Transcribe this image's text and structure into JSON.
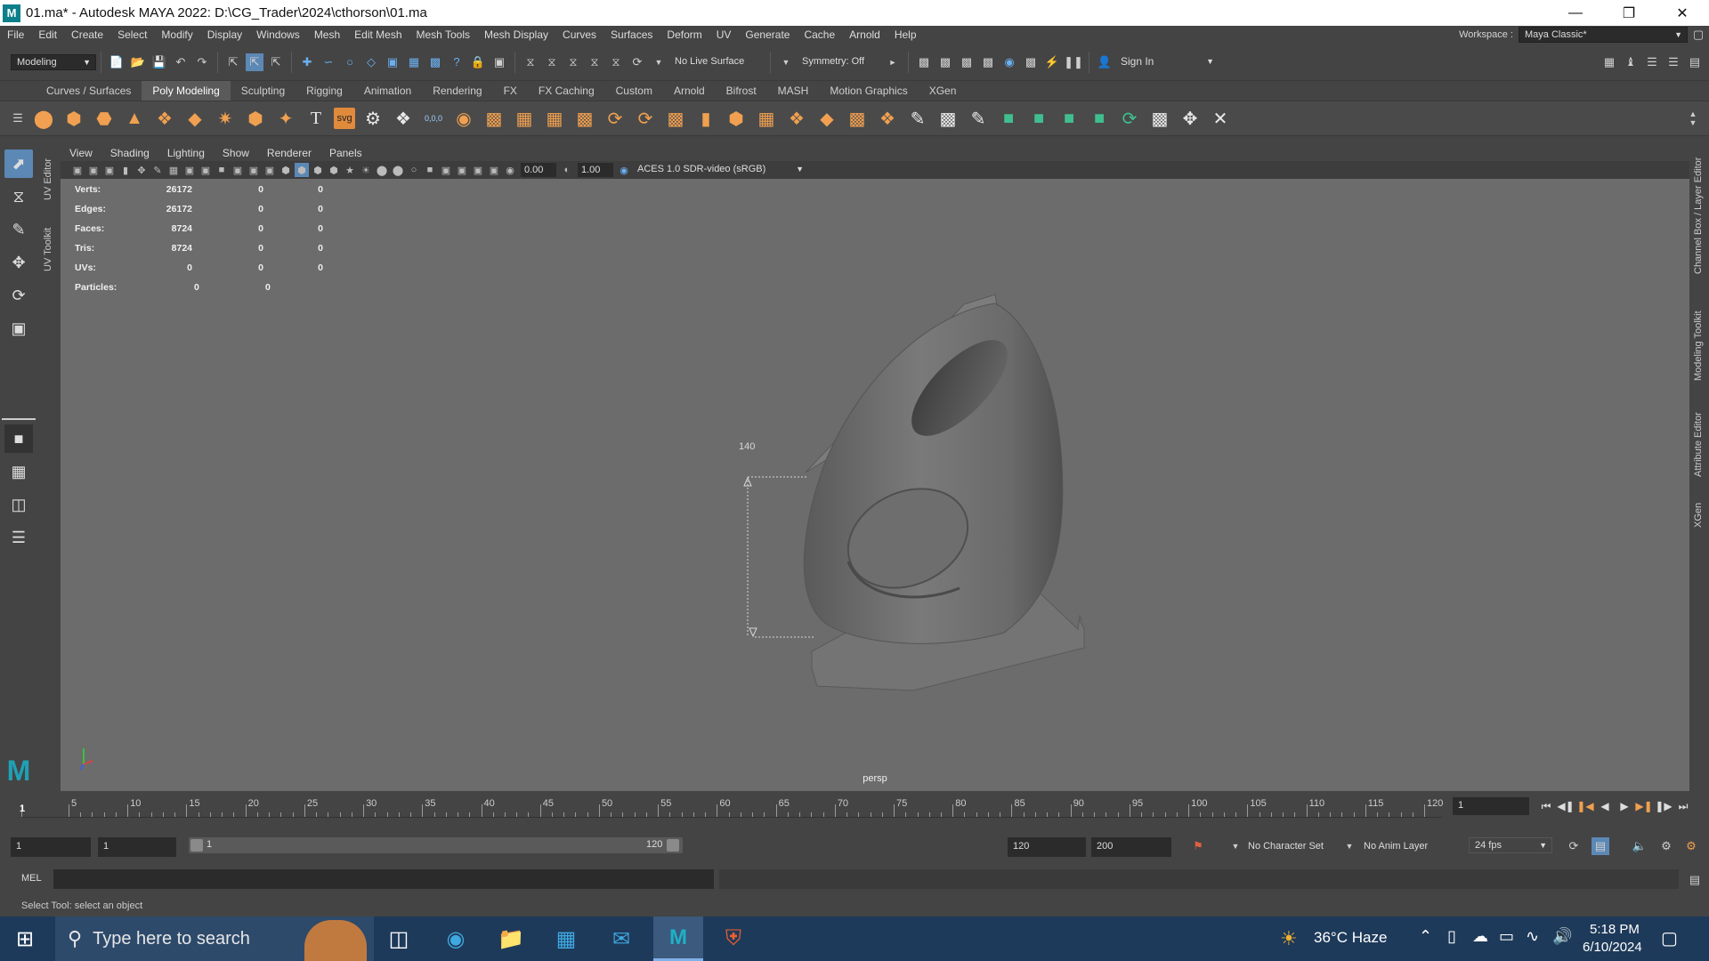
{
  "window": {
    "title": "01.ma* - Autodesk MAYA 2022: D:\\CG_Trader\\2024\\cthorson\\01.ma",
    "logo_letter": "M"
  },
  "menubar": {
    "items": [
      "File",
      "Edit",
      "Create",
      "Select",
      "Modify",
      "Display",
      "Windows",
      "Mesh",
      "Edit Mesh",
      "Mesh Tools",
      "Mesh Display",
      "Curves",
      "Surfaces",
      "Deform",
      "UV",
      "Generate",
      "Cache",
      "Arnold",
      "Help"
    ],
    "workspace_label": "Workspace :",
    "workspace_value": "Maya Classic*"
  },
  "statusline": {
    "mode": "Modeling",
    "live_surface": "No Live Surface",
    "symmetry": "Symmetry: Off",
    "sign_in": "Sign In"
  },
  "shelf": {
    "tabs": [
      "Curves / Surfaces",
      "Poly Modeling",
      "Sculpting",
      "Rigging",
      "Animation",
      "Rendering",
      "FX",
      "FX Caching",
      "Custom",
      "Arnold",
      "Bifrost",
      "MASH",
      "Motion Graphics",
      "XGen"
    ],
    "active_tab": "Poly Modeling",
    "svg_label": "svg",
    "text_label": "T",
    "num_label": "0,0,0"
  },
  "left_vertical_tabs": [
    "UV Editor",
    "UV Toolkit"
  ],
  "right_vertical_tabs": [
    "Channel Box / Layer Editor",
    "Modeling Toolkit",
    "Attribute Editor",
    "XGen"
  ],
  "panel": {
    "menus": [
      "View",
      "Shading",
      "Lighting",
      "Show",
      "Renderer",
      "Panels"
    ],
    "exposure": "0.00",
    "gamma": "1.00",
    "color_space": "ACES 1.0 SDR-video (sRGB)",
    "camera": "persp"
  },
  "hud": {
    "rows": [
      {
        "label": "Verts:",
        "v1": "26172",
        "v2": "0",
        "v3": "0"
      },
      {
        "label": "Edges:",
        "v1": "26172",
        "v2": "0",
        "v3": "0"
      },
      {
        "label": "Faces:",
        "v1": "8724",
        "v2": "0",
        "v3": "0"
      },
      {
        "label": "Tris:",
        "v1": "8724",
        "v2": "0",
        "v3": "0"
      },
      {
        "label": "UVs:",
        "v1": "0",
        "v2": "0",
        "v3": "0"
      }
    ],
    "particles": {
      "label": "Particles:",
      "v1": "0",
      "v2": "0"
    }
  },
  "dimension_label": "140",
  "timeline": {
    "ticks": [
      "5",
      "10",
      "15",
      "20",
      "25",
      "30",
      "35",
      "40",
      "45",
      "50",
      "55",
      "60",
      "65",
      "70",
      "75",
      "80",
      "85",
      "90",
      "95",
      "100",
      "105",
      "110",
      "115",
      "120"
    ],
    "start_label": "1",
    "current_frame": "1"
  },
  "range": {
    "start": "1",
    "playback_start": "1",
    "slider_start": "1",
    "slider_end": "120",
    "playback_end": "120",
    "end": "200",
    "character_set": "No Character Set",
    "anim_layer": "No Anim Layer",
    "fps": "24 fps"
  },
  "command": {
    "label": "MEL",
    "help": "Select Tool: select an object"
  },
  "taskbar": {
    "search_placeholder": "Type here to search",
    "weather": "36°C  Haze",
    "time": "5:18 PM",
    "date": "6/10/2024"
  }
}
